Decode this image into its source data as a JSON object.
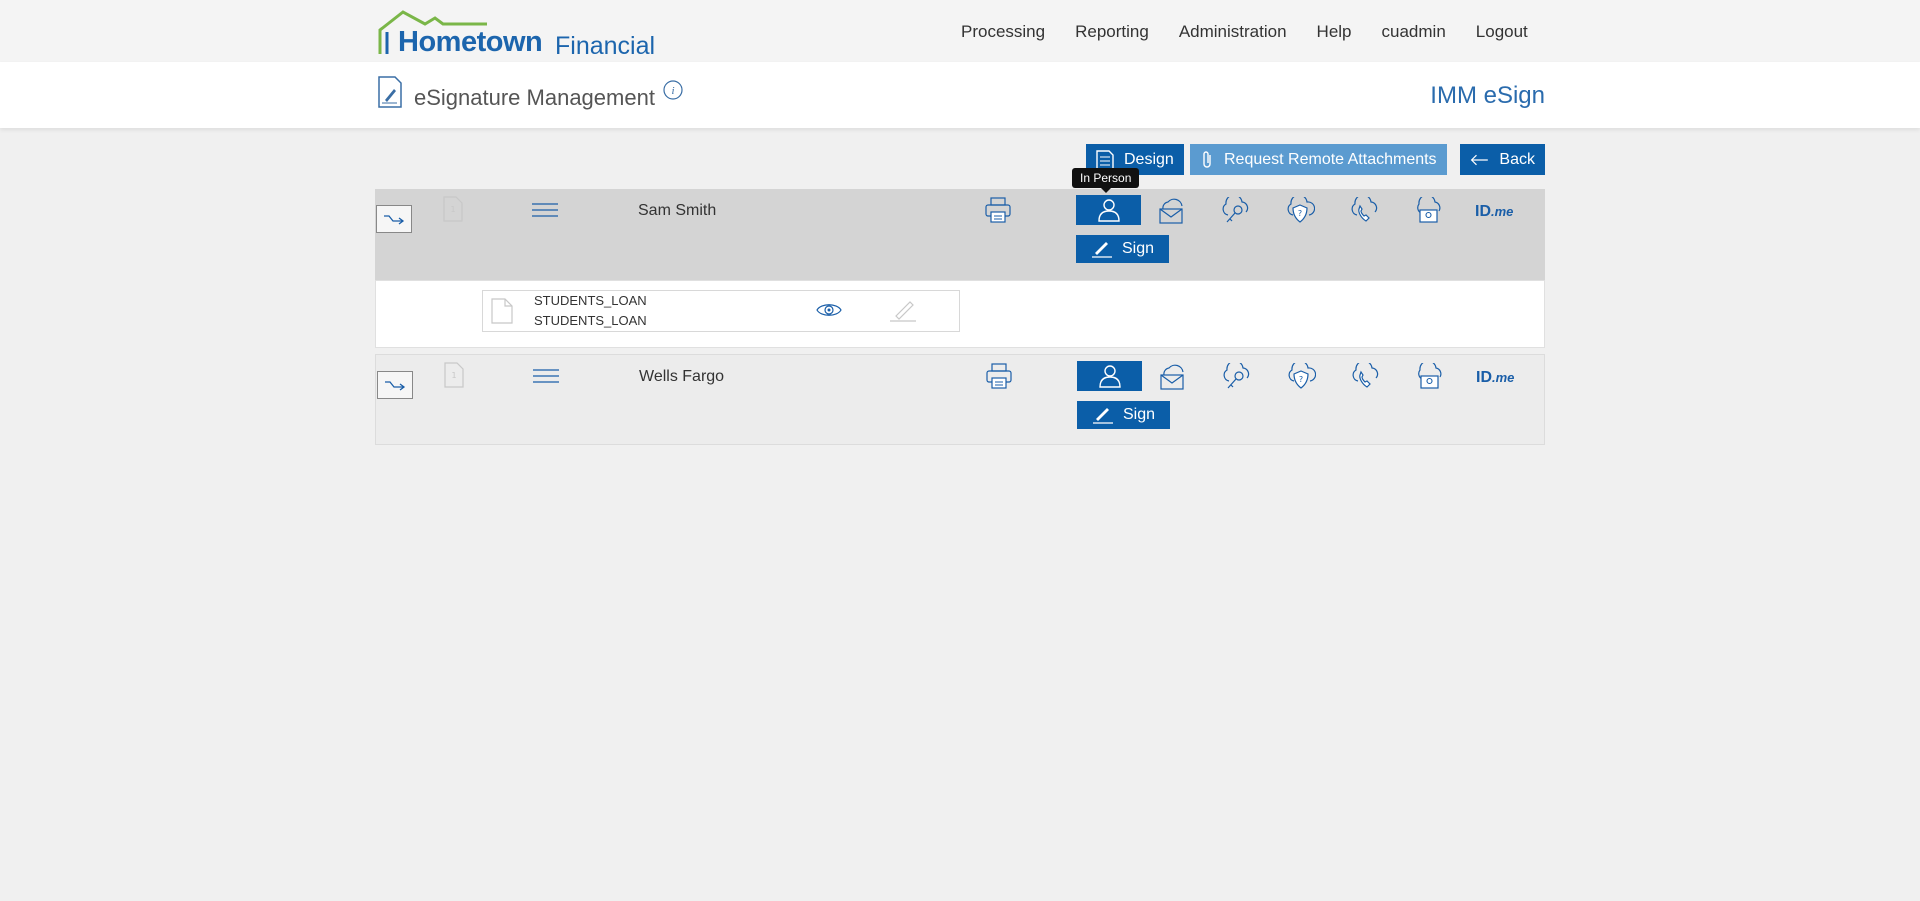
{
  "brand": {
    "name": "Hometown",
    "suffix": "Financial",
    "colors": {
      "primary": "#1c65ad",
      "roof": "#7ab648"
    }
  },
  "nav": {
    "items": [
      "Processing",
      "Reporting",
      "Administration",
      "Help",
      "cuadmin",
      "Logout"
    ]
  },
  "header": {
    "page_title": "eSignature Management",
    "product_title": "IMM eSign",
    "page_icon": "signature-document-icon",
    "info_icon": "info-icon"
  },
  "toolbar": {
    "design_label": "Design",
    "request_label": "Request Remote Attachments",
    "back_label": "Back"
  },
  "tooltip": {
    "text": "In Person"
  },
  "recipients": [
    {
      "name": "Sam Smith",
      "sign_label": "Sign",
      "auth_methods": [
        "in-person-icon",
        "email-icon",
        "cloud-key-icon",
        "cloud-question-icon",
        "cloud-phone-icon",
        "cloud-id-icon",
        "idme-icon"
      ],
      "documents": [
        {
          "name": "STUDENTS_LOAN",
          "subtitle": "STUDENTS_LOAN"
        }
      ]
    },
    {
      "name": "Wells Fargo",
      "sign_label": "Sign",
      "auth_methods": [
        "in-person-icon",
        "email-icon",
        "cloud-key-icon",
        "cloud-question-icon",
        "cloud-phone-icon",
        "cloud-id-icon",
        "idme-icon"
      ]
    }
  ],
  "idme": {
    "main": "ID",
    "suffix": ".me"
  },
  "colors": {
    "accent": "#0b5ea8",
    "accent_light": "#5b9bd0",
    "row_active": "#d4d4d4",
    "row_inactive": "#ececec"
  }
}
